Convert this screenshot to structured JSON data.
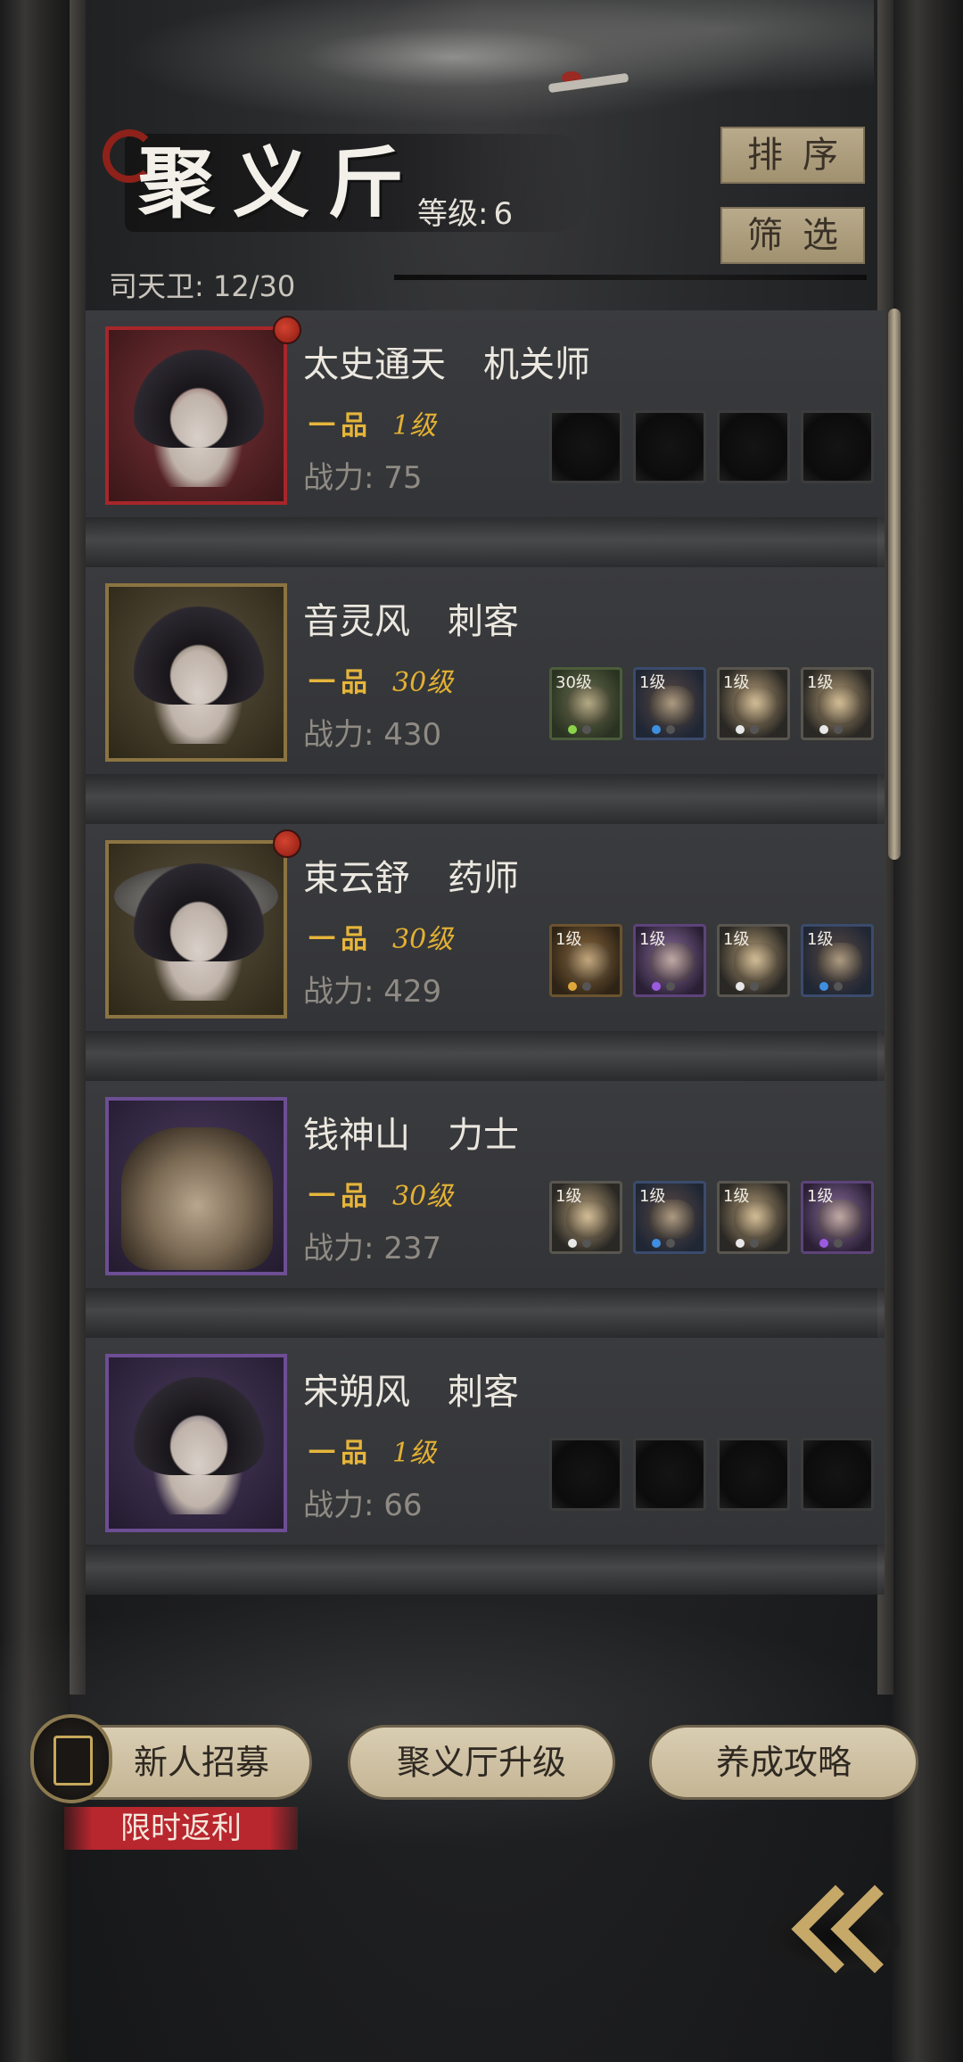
{
  "header": {
    "title": "聚义斤",
    "level_label": "等级:",
    "level_value": "6",
    "guard_label": "司天卫:",
    "guard_count": "12/30",
    "sort_label": "排序",
    "filter_label": "筛选"
  },
  "heroes": [
    {
      "name": "太史通天",
      "class": "机关师",
      "rank": "一品",
      "level": "1级",
      "power_label": "战力:",
      "power": "75",
      "frame": "red",
      "has_alert": true,
      "equipment": [
        {
          "level": "",
          "rarity": "empty"
        },
        {
          "level": "",
          "rarity": "empty"
        },
        {
          "level": "",
          "rarity": "empty"
        },
        {
          "level": "",
          "rarity": "empty"
        }
      ]
    },
    {
      "name": "音灵风",
      "class": "刺客",
      "rank": "一品",
      "level": "30级",
      "power_label": "战力:",
      "power": "430",
      "frame": "gold",
      "has_alert": false,
      "equipment": [
        {
          "level": "30级",
          "rarity": "green"
        },
        {
          "level": "1级",
          "rarity": "blue"
        },
        {
          "level": "1级",
          "rarity": "white"
        },
        {
          "level": "1级",
          "rarity": "white"
        }
      ]
    },
    {
      "name": "束云舒",
      "class": "药师",
      "rank": "一品",
      "level": "30级",
      "power_label": "战力:",
      "power": "429",
      "frame": "gold",
      "has_alert": true,
      "equipment": [
        {
          "level": "1级",
          "rarity": "gold"
        },
        {
          "level": "1级",
          "rarity": "purple"
        },
        {
          "level": "1级",
          "rarity": "white"
        },
        {
          "level": "1级",
          "rarity": "blue"
        }
      ]
    },
    {
      "name": "钱神山",
      "class": "力士",
      "rank": "一品",
      "level": "30级",
      "power_label": "战力:",
      "power": "237",
      "frame": "purple",
      "has_alert": false,
      "equipment": [
        {
          "level": "1级",
          "rarity": "white"
        },
        {
          "level": "1级",
          "rarity": "blue"
        },
        {
          "level": "1级",
          "rarity": "white"
        },
        {
          "level": "1级",
          "rarity": "purple"
        }
      ]
    },
    {
      "name": "宋朔风",
      "class": "刺客",
      "rank": "一品",
      "level": "1级",
      "power_label": "战力:",
      "power": "66",
      "frame": "purple",
      "has_alert": false,
      "equipment": [
        {
          "level": "",
          "rarity": "empty"
        },
        {
          "level": "",
          "rarity": "empty"
        },
        {
          "level": "",
          "rarity": "empty"
        },
        {
          "level": "",
          "rarity": "empty"
        }
      ]
    }
  ],
  "bottom": {
    "recruit_label": "新人招募",
    "recruit_banner": "限时返利",
    "upgrade_label": "聚义厅升级",
    "guide_label": "养成攻略"
  },
  "colors": {
    "gold_text": "#e2b033",
    "alert_red": "#b8262e",
    "button_beige": "#c4b594"
  }
}
